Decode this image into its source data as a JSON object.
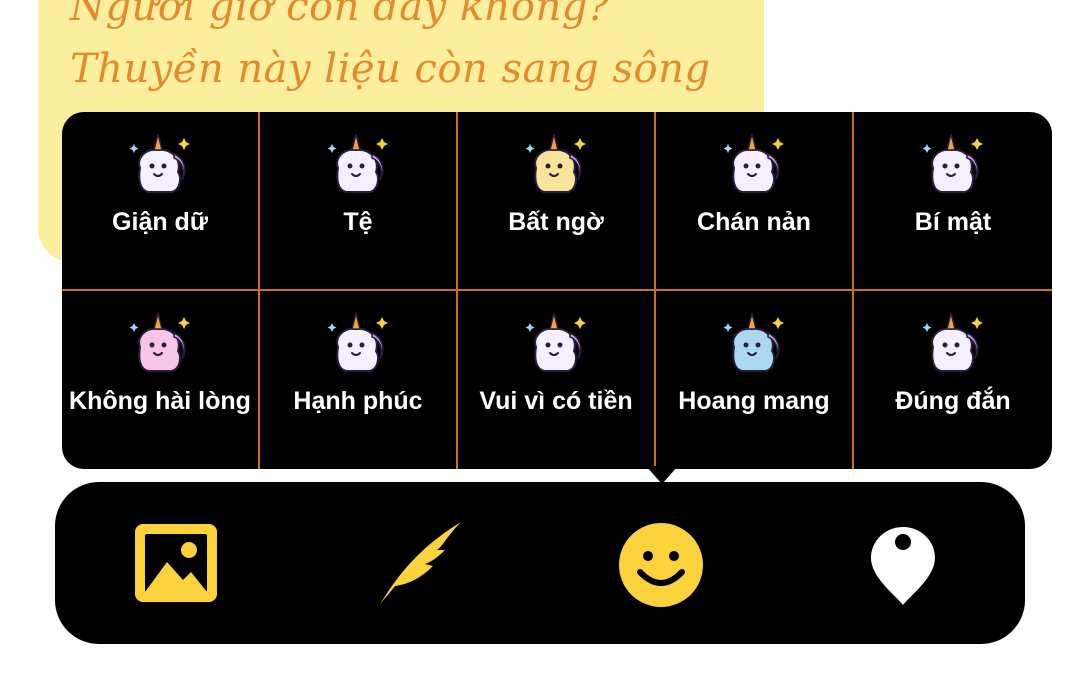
{
  "note": {
    "line1": "Người giờ còn đây không?",
    "line2": "Thuyền này liệu còn sang sông"
  },
  "moods": [
    {
      "label": "Giận dữ",
      "icon": "angry-unicorn-icon",
      "color": "#f4f0ff"
    },
    {
      "label": "Tệ",
      "icon": "sleepy-unicorn-icon",
      "color": "#f4f0ff"
    },
    {
      "label": "Bất ngờ",
      "icon": "surprised-unicorn-icon",
      "color": "#f8e39a"
    },
    {
      "label": "Chán nản",
      "icon": "bored-unicorn-icon",
      "color": "#f4f0ff"
    },
    {
      "label": "Bí mật",
      "icon": "mermaid-unicorn-icon",
      "color": "#f4f0ff"
    },
    {
      "label": "Không hài lòng",
      "icon": "dancing-unicorn-icon",
      "color": "#f6c6e6"
    },
    {
      "label": "Hạnh phúc",
      "icon": "happy-unicorn-icon",
      "color": "#f4f0ff"
    },
    {
      "label": "Vui vì có tiền",
      "icon": "rich-unicorn-icon",
      "color": "#f4f0ff"
    },
    {
      "label": "Hoang mang",
      "icon": "confused-unicorn-icon",
      "color": "#a9d8f0"
    },
    {
      "label": "Đúng đắn",
      "icon": "approving-unicorn-icon",
      "color": "#f4f0ff"
    }
  ],
  "toolbar": {
    "image": "image-icon",
    "feather": "feather-icon",
    "smile": "smiley-icon",
    "pin": "location-pin-icon"
  },
  "colors": {
    "accent": "#f9d23c",
    "divider": "#c96f26",
    "note_bg": "#fbef9e",
    "note_text": "#e48a2c"
  }
}
